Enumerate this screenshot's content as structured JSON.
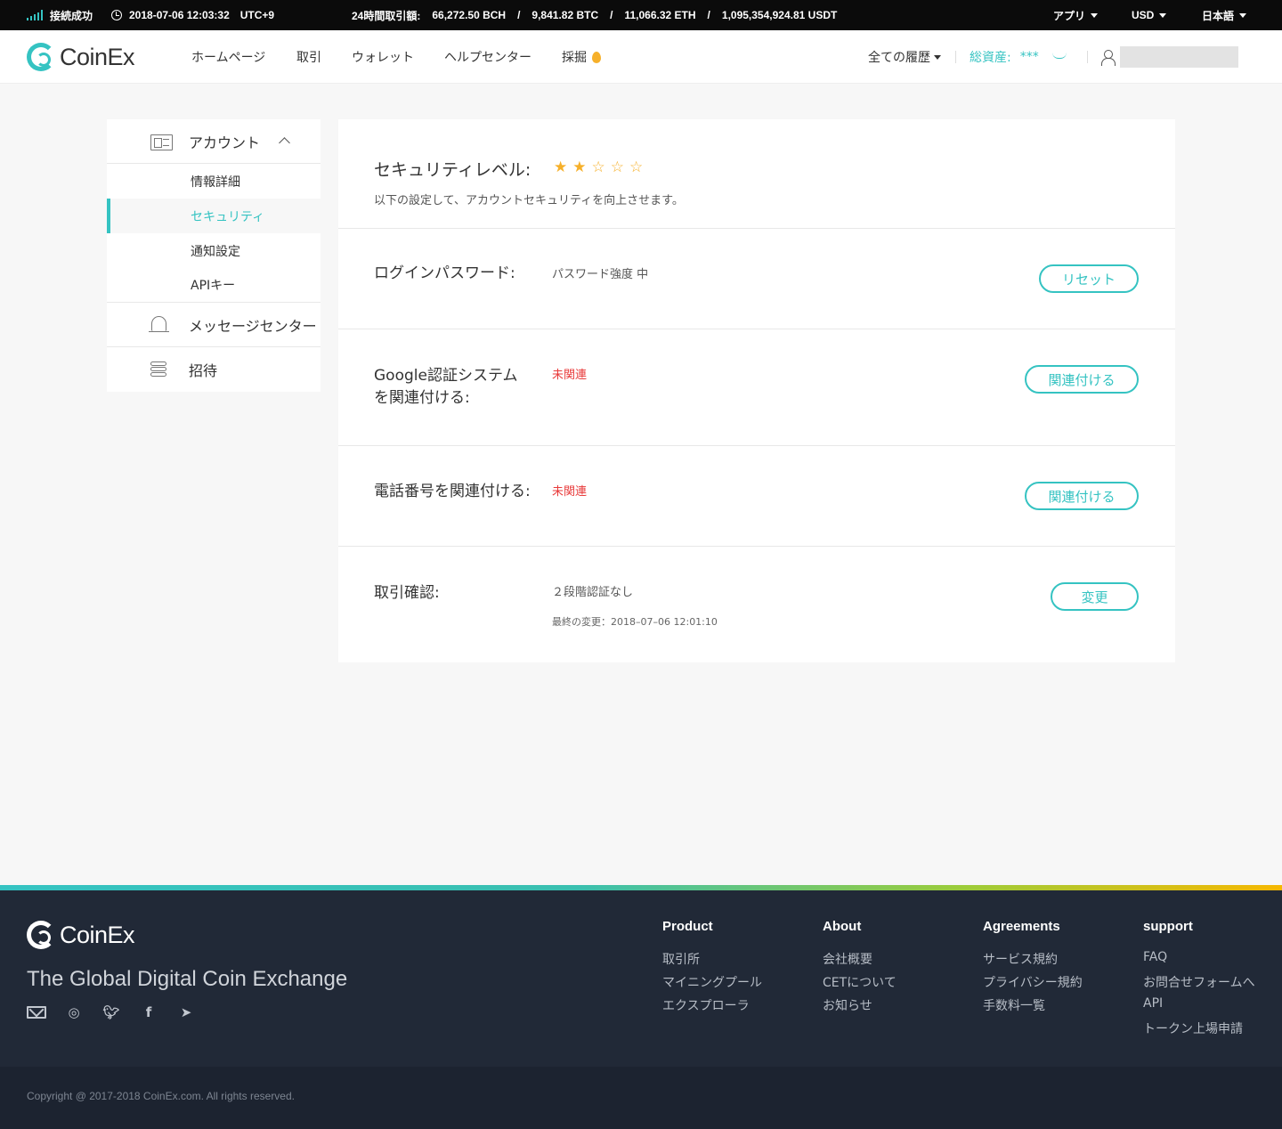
{
  "topbar": {
    "connection": "接続成功",
    "datetime": "2018-07-06 12:03:32",
    "timezone": "UTC+9",
    "volume_label": "24時間取引額:",
    "volume_bch": "66,272.50 BCH",
    "volume_btc": "9,841.82 BTC",
    "volume_eth": "11,066.32 ETH",
    "volume_usdt": "1,095,354,924.81 USDT",
    "divider": "/",
    "app": "アプリ",
    "currency": "USD",
    "language": "日本語"
  },
  "header": {
    "logo": "CoinEx",
    "nav": {
      "home": "ホームページ",
      "trade": "取引",
      "wallet": "ウォレット",
      "help": "ヘルプセンター",
      "mining": "採掘"
    },
    "history": "全ての履歴",
    "assets_label": "総資産:",
    "assets_value": "***"
  },
  "sidebar": {
    "account": "アカウント",
    "info": "情報詳細",
    "security": "セキュリティ",
    "notifications": "通知設定",
    "api": "APIキー",
    "messages": "メッセージセンター",
    "invite": "招待"
  },
  "security": {
    "title": "セキュリティレベル:",
    "rating": 2,
    "rating_max": 5,
    "star_filled": "★",
    "star_empty": "☆",
    "description": "以下の設定して、アカウントセキュリティを向上させます。",
    "password": {
      "label": "ログインパスワード:",
      "value": "パスワード強度 中",
      "button": "リセット"
    },
    "google": {
      "label_line1": "Google認証システム",
      "label_line2": "を関連付ける:",
      "value": "未関連",
      "button": "関連付ける"
    },
    "phone": {
      "label": "電話番号を関連付ける:",
      "value": "未関連",
      "button": "関連付ける"
    },
    "trade_confirm": {
      "label": "取引確認:",
      "value": "２段階認証なし",
      "last_changed": "最終の変更：2018–07–06 12:01:10",
      "button": "変更"
    }
  },
  "footer": {
    "logo": "CoinEx",
    "tagline": "The Global Digital Coin Exchange",
    "product": {
      "title": "Product",
      "links": [
        "取引所",
        "マイニングプール",
        "エクスプローラ"
      ]
    },
    "about": {
      "title": "About",
      "links": [
        "会社概要",
        "CETについて",
        "お知らせ"
      ]
    },
    "agreements": {
      "title": "Agreements",
      "links": [
        "サービス規約",
        "プライバシー規約",
        "手数料一覧"
      ]
    },
    "support": {
      "title": "support",
      "links": [
        "FAQ",
        "お問合せフォームへ",
        "API",
        "トークン上場申請"
      ]
    },
    "copyright": "Copyright @ 2017-2018 CoinEx.com. All rights reserved."
  },
  "colors": {
    "accent": "#35c3c2",
    "alert": "#e83a3a",
    "star": "#f6b02a",
    "footer_bg": "#212937"
  }
}
